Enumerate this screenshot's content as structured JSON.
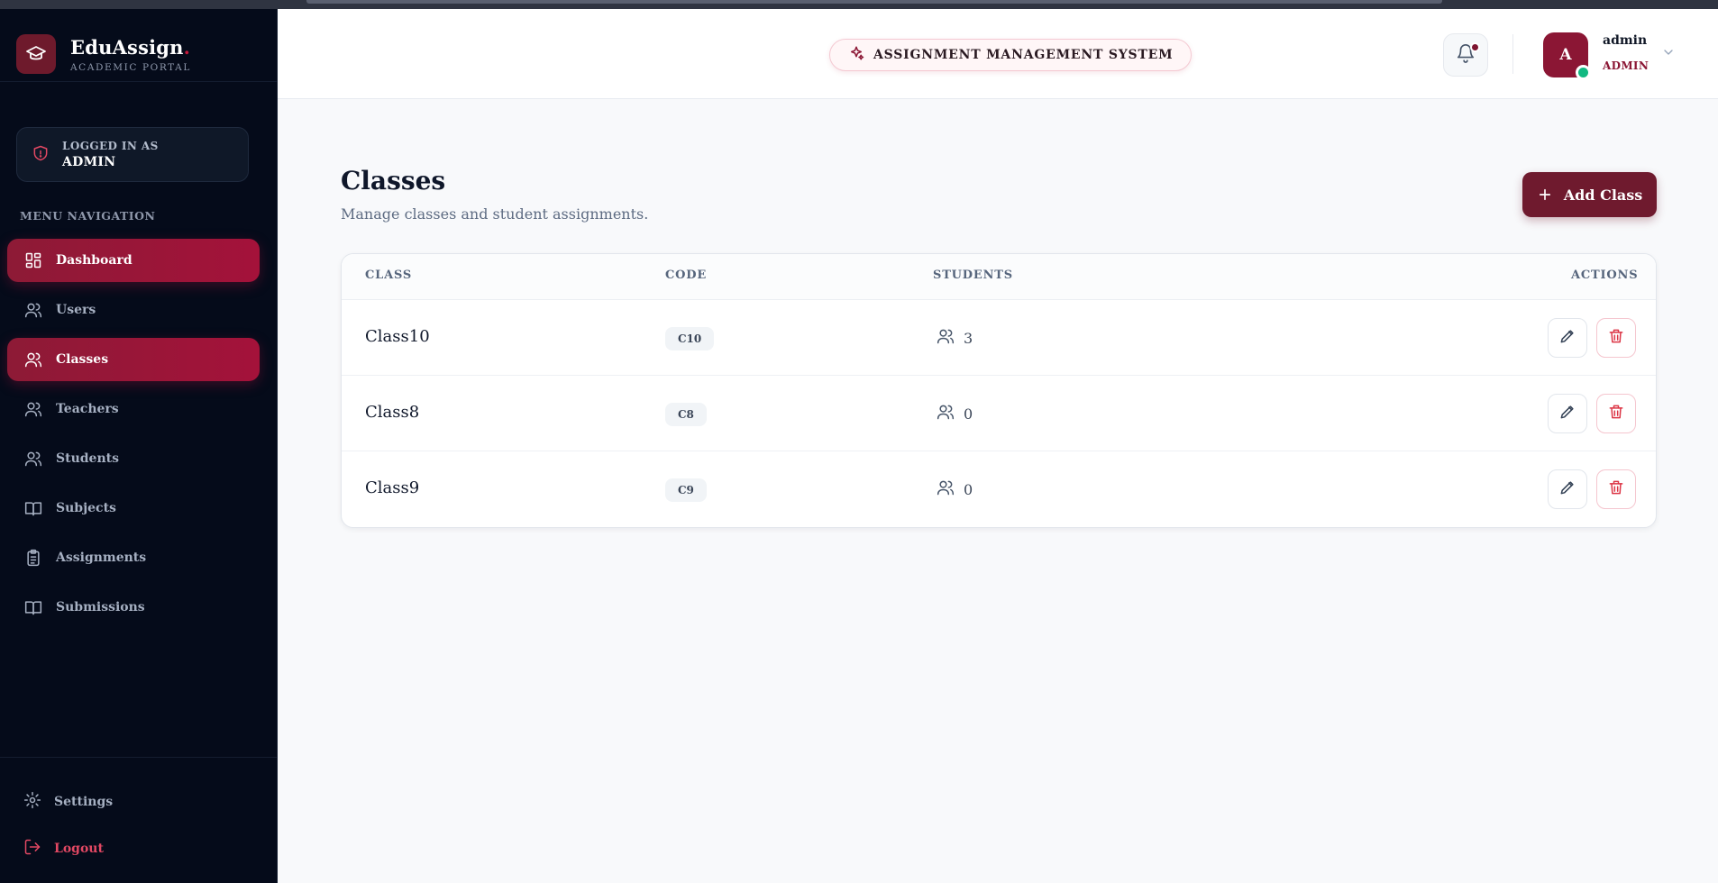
{
  "brand": {
    "name": "EduAssign",
    "dot": ".",
    "subtitle": "ACADEMIC PORTAL",
    "icon": "graduation-cap-icon"
  },
  "session": {
    "label": "LOGGED IN AS",
    "role": "ADMIN",
    "icon": "shield-icon"
  },
  "menu": {
    "heading": "MENU NAVIGATION",
    "items": [
      {
        "label": "Dashboard",
        "icon": "dashboard-icon",
        "active": true
      },
      {
        "label": "Users",
        "icon": "users-icon",
        "active": false
      },
      {
        "label": "Classes",
        "icon": "users-icon",
        "active": true
      },
      {
        "label": "Teachers",
        "icon": "users-icon",
        "active": false
      },
      {
        "label": "Students",
        "icon": "users-icon",
        "active": false
      },
      {
        "label": "Subjects",
        "icon": "book-icon",
        "active": false
      },
      {
        "label": "Assignments",
        "icon": "clipboard-icon",
        "active": false
      },
      {
        "label": "Submissions",
        "icon": "book-icon",
        "active": false
      }
    ],
    "settings": "Settings",
    "logout": "Logout"
  },
  "header": {
    "system_title": "ASSIGNMENT MANAGEMENT SYSTEM",
    "user": {
      "initial": "A",
      "name": "admin",
      "role": "ADMIN"
    }
  },
  "page": {
    "title": "Classes",
    "subtitle": "Manage classes and student assignments.",
    "add_button": "Add Class"
  },
  "table": {
    "headers": {
      "class": "CLASS",
      "code": "CODE",
      "students": "STUDENTS",
      "actions": "ACTIONS"
    },
    "rows": [
      {
        "name": "Class10",
        "code": "C10",
        "students": "3"
      },
      {
        "name": "Class8",
        "code": "C8",
        "students": "0"
      },
      {
        "name": "Class9",
        "code": "C9",
        "students": "0"
      }
    ]
  },
  "colors": {
    "accent": "#8b1634",
    "sidebar_bg": "#050b1a",
    "online": "#12b981",
    "danger": "#dc3545"
  }
}
